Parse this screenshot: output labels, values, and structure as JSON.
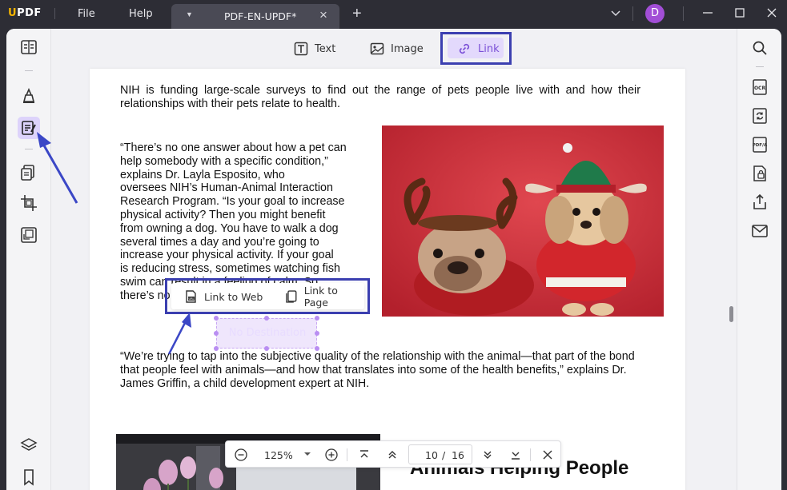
{
  "app": {
    "logo_text": "UPDF",
    "menu": [
      "File",
      "Help"
    ],
    "tab_title": "PDF-EN-UPDF*",
    "avatar_letter": "D"
  },
  "edit_toolbar": {
    "text_label": "Text",
    "image_label": "Image",
    "link_label": "Link"
  },
  "document": {
    "para1": "NIH is funding large-scale surveys to find out the range of pets people live with and how their relationships with their pets relate to health.",
    "para2_lines": [
      "“There’s no one answer about how a pet can",
      "help somebody with a  specific condition,”",
      "explains  Dr.  Layla  Esposito,  who",
      "oversees NIH’s Human-Animal  Interaction",
      "Research Program. “Is your goal to increase",
      "physical activity? Then you might benefit",
      "from owning a dog. You have to walk a dog",
      "several times a day and you’re going to",
      "increase your physical activity.  If your goal",
      "is reducing stress, sometimes watching fish",
      "swim can result in a feeling of calm. So",
      "there’s no one type."
    ],
    "para3": "“We’re trying to tap into the subjective quality of the relationship with the animal—that part of the bond that people feel with animals—and how that translates into some of the health benefits,” explains Dr. James Griffin, a child development expert at NIH.",
    "heading2": "Animals Helping People"
  },
  "link_popup": {
    "link_to_web": "Link to Web",
    "link_to_page": "Link to Page",
    "placeholder": "No Destination"
  },
  "zoom_bar": {
    "zoom": "125%",
    "current_page": "10",
    "page_sep": "/",
    "total_pages": "16"
  },
  "colors": {
    "accent": "#3b3fb0",
    "link_highlight": "#e3d9fc",
    "avatar": "#a24ed6"
  }
}
